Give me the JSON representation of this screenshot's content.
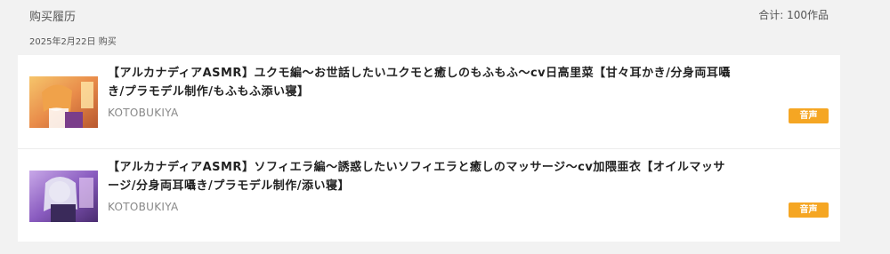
{
  "header": {
    "title": "购买履历",
    "total": "合计: 100作品"
  },
  "date_label": "2025年2月22日 购买",
  "items": [
    {
      "title": "【アルカナディアASMR】ユクモ編～お世話したいユクモと癒しのもふもふ～cv日高里菜【甘々耳かき/分身両耳囁き/プラモデル制作/もふもふ添い寝】",
      "maker": "KOTOBUKIYA",
      "badge": "音声"
    },
    {
      "title": "【アルカナディアASMR】ソフィエラ編～誘惑したいソフィエラと癒しのマッサージ～cv加隈亜衣【オイルマッサージ/分身両耳囁き/プラモデル制作/添い寝】",
      "maker": "KOTOBUKIYA",
      "badge": "音声"
    }
  ],
  "colors": {
    "badge": "#f5a623",
    "background": "#f2f2f2",
    "card": "#ffffff"
  }
}
